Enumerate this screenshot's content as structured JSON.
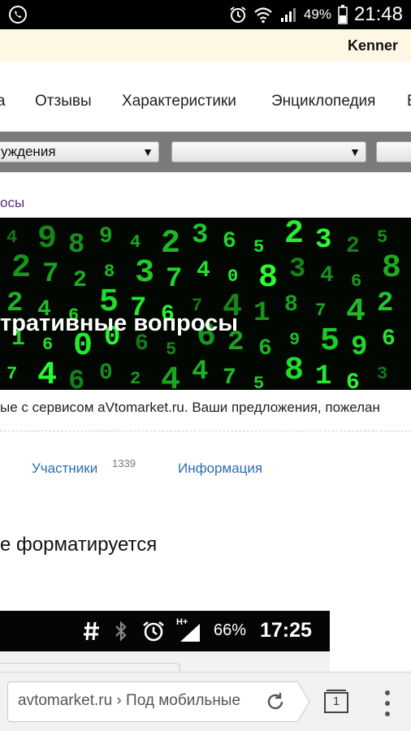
{
  "statusbar": {
    "battery_pct": "49%",
    "time": "21:48"
  },
  "user": {
    "name": "Kenner"
  },
  "nav": {
    "items": [
      "а",
      "Отзывы",
      "Характеристики",
      "Энциклопедия",
      "Б"
    ]
  },
  "selects": {
    "first_value": "уждения",
    "second_value": ""
  },
  "breadcrumb": "осы",
  "banner": {
    "title": "тративные вопросы",
    "digits": [
      "4",
      "2",
      "2",
      "1",
      "7",
      "9",
      "7",
      "4",
      "6",
      "4",
      "8",
      "2",
      "6",
      "0",
      "6",
      "9",
      "8",
      "5",
      "0",
      "0",
      "4",
      "3",
      "7",
      "6",
      "2",
      "2",
      "7",
      "6",
      "5",
      "4",
      "3",
      "4",
      "7",
      "6",
      "4",
      "6",
      "0",
      "4",
      "2",
      "7",
      "5",
      "8",
      "1",
      "6",
      "5",
      "2",
      "3",
      "8",
      "9",
      "8",
      "3",
      "4",
      "7",
      "5",
      "1",
      "2",
      "6",
      "4",
      "9",
      "6",
      "5",
      "8",
      "2",
      "6",
      "3"
    ]
  },
  "description": "ые с сервисом aVtomarket.ru. Ваши предложения, пожелан",
  "tabs": {
    "members_label": "Участники",
    "members_count": "1339",
    "info_label": "Информация"
  },
  "content": {
    "heading": "е форматируется",
    "embedded_status": {
      "network": "H+",
      "battery_pct": "66%",
      "time": "17:25"
    }
  },
  "browser": {
    "url": "avtomarket.ru › Под мобильные",
    "tab_count": "1"
  }
}
